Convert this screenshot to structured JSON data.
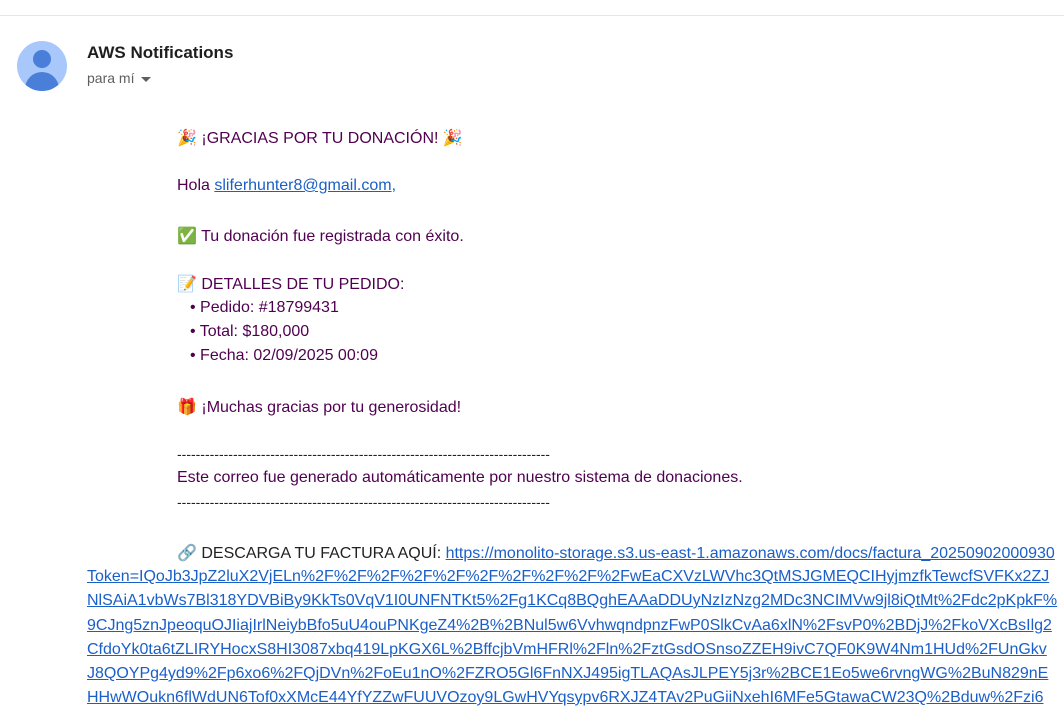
{
  "header": {
    "sender": "AWS Notifications",
    "recipient": "para mí"
  },
  "message": {
    "title": "¡GRACIAS POR TU DONACIÓN!",
    "title_emoji": "🎉",
    "greeting": "Hola ",
    "email": "sliferhunter8@gmail.com",
    "comma": ",",
    "success_emoji": "✅",
    "success": "Tu donación fue registrada con éxito.",
    "details_emoji": "📝",
    "details_heading": "DETALLES DE TU PEDIDO:",
    "order": "• Pedido: #18799431",
    "total": "• Total: $180,000",
    "date": "• Fecha: 02/09/2025 00:09",
    "thanks_emoji": "🎁",
    "thanks": "¡Muchas gracias por tu generosidad!",
    "separator": "--------------------------------------------------------------------------------",
    "auto_note": "Este correo fue generado automáticamente por nuestro sistema de donaciones.",
    "download_emoji": "🔗",
    "download_label": "DESCARGA TU FACTURA AQUÍ: ",
    "url_lines": [
      "https://monolito-storage.s3.us-east-1.amazonaws.com/docs/factura_20250902000930",
      "Token=IQoJb3JpZ2luX2VjELn%2F%2F%2F%2F%2F%2F%2F%2F%2F%2FwEaCXVzLWVhc3QtMSJGMEQCIHyjmzfkTewcfSVFKx2ZJ",
      "NlSAiA1vbWs7Bl318YDVBiBy9KkTs0VqV1I0UNFNTKt5%2Fg1KCq8BQghEAAaDDUyNzIzNzg2MDc3NCIMVw9jl8iQtMt%2Fdc2pKpkF%",
      "9CJng5znJpeoquOJIiajIrlNeiybBfo5uU4ouPNKgeZ4%2B%2BNul5w6VvhwqndpnzFwP0SlkCvAa6xlN%2FsvP0%2BDjJ%2FkoVXcBsIlg2",
      "CfdoYk0ta6tZLIRYHocxS8HI3087xbq419LpKGX6L%2BffcjbVmHFRl%2Fln%2FztGsdOSnsoZZEH9ivC7QF0K9W4Nm1HUd%2FUnGkv",
      "J8QOYPg4yd9%2Fp6xo6%2FQjDVn%2FoEu1nO%2FZRO5Gl6FnNXJ495igTLAQAsJLPEY5j3r%2BCE1Eo5we6rvngWG%2BuN829nE",
      "HHwWOukn6flWdUN6Tof0xXMcE44YfYZZwFUUVOzoy9LGwHVYqsypv6RXJZ4TAv2PuGiiNxehI6MFe5GtawaCW23Q%2Bduw%2Fzi6"
    ]
  }
}
